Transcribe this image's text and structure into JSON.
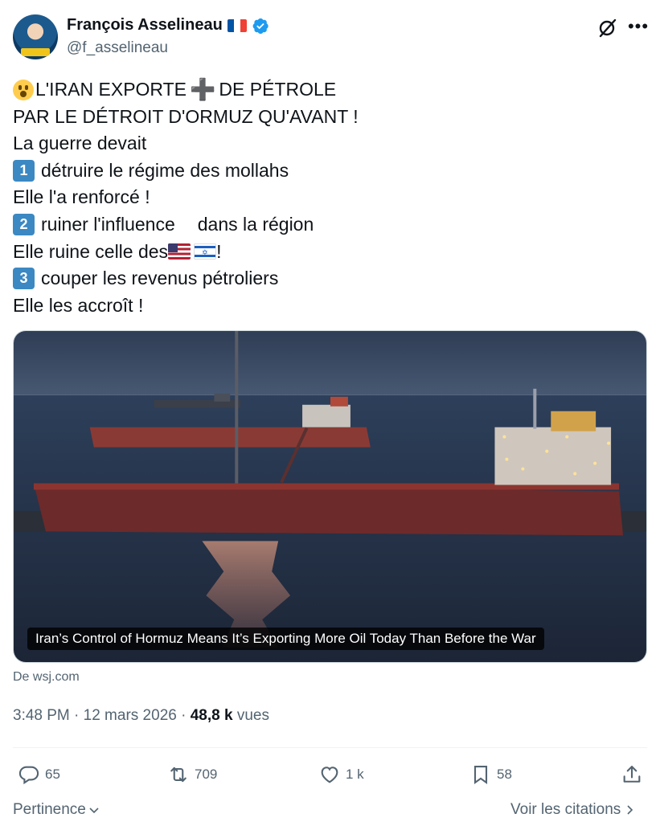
{
  "author": {
    "name": "François Asselineau",
    "handle": "@f_asselineau"
  },
  "tweet": {
    "line1": "L'IRAN EXPORTE",
    "line1b": "DE PÉTROLE",
    "line2": "PAR LE DÉTROIT D'ORMUZ QU'AVANT !",
    "line3": "La guerre devait",
    "item1_num": "1",
    "item1": "détruire le régime des mollahs",
    "line5": "Elle l'a renforcé !",
    "item2_num": "2",
    "item2a": "ruiner l'influence",
    "item2b": "dans la région",
    "line7a": "Elle ruine celle des",
    "line7b": " !",
    "item3_num": "3",
    "item3": "couper les revenus pétroliers",
    "line9": "Elle les accroît !"
  },
  "media": {
    "caption": "Iran’s Control of Hormuz Means It’s Exporting More Oil Today Than Before the War",
    "source": "De wsj.com"
  },
  "meta": {
    "time": "3:48 PM · 12 mars 2026 · ",
    "views_count": "48,8 k",
    "views_label": " vues"
  },
  "actions": {
    "replies": "65",
    "reposts": "709",
    "likes": "1 k",
    "bookmarks": "58"
  },
  "footer": {
    "sort_label": "Pertinence",
    "quotes_label": "Voir les citations"
  },
  "colors": {
    "accent": "#1d9bf0",
    "secondary_text": "#536471"
  }
}
